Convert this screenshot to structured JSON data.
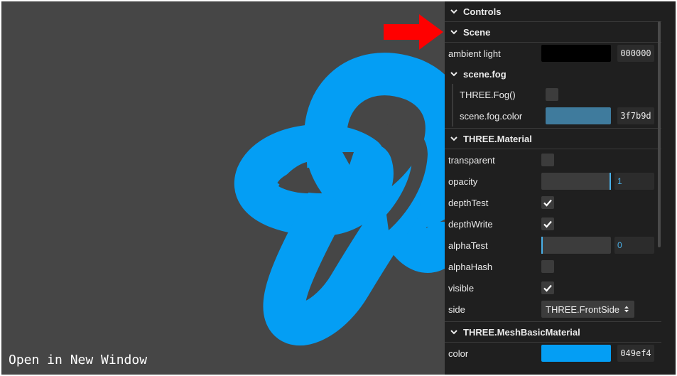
{
  "viewport": {
    "link_text": "Open in New Window",
    "background": "#464646",
    "mesh_color": "#049ef4"
  },
  "gui": {
    "root_title": "Controls",
    "scene": {
      "title": "Scene",
      "ambient_label": "ambient light",
      "ambient_hex": "000000",
      "ambient_color": "#000000",
      "fog_folder": {
        "title": "scene.fog",
        "fog_label": "THREE.Fog()",
        "fog_checked": false,
        "fog_color_label": "scene.fog.color",
        "fog_color_hex": "3f7b9d",
        "fog_color": "#3f7b9d"
      }
    },
    "material": {
      "title": "THREE.Material",
      "transparent_label": "transparent",
      "transparent_checked": false,
      "opacity_label": "opacity",
      "opacity_value": "1",
      "depth_test_label": "depthTest",
      "depth_test_checked": true,
      "depth_write_label": "depthWrite",
      "depth_write_checked": true,
      "alpha_test_label": "alphaTest",
      "alpha_test_value": "0",
      "alpha_hash_label": "alphaHash",
      "alpha_hash_checked": false,
      "visible_label": "visible",
      "visible_checked": true,
      "side_label": "side",
      "side_value": "THREE.FrontSide"
    },
    "basic_material": {
      "title": "THREE.MeshBasicMaterial",
      "color_label": "color",
      "color_hex": "049ef4",
      "color": "#049ef4"
    }
  },
  "annotation": {
    "arrow_color": "#ff0000"
  },
  "icons": {
    "folder": "chevron-down-icon",
    "check": "checkmark-icon",
    "select": "up-down-arrows-icon",
    "arrow": "red-arrow-icon"
  }
}
